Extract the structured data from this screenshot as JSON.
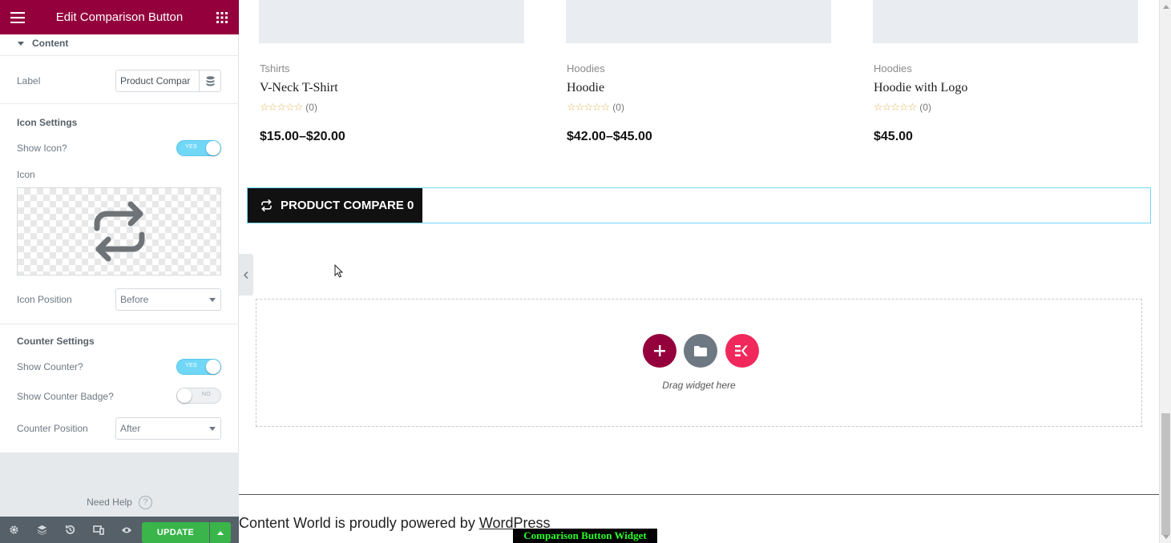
{
  "panel": {
    "title": "Edit Comparison Button",
    "section": "Content",
    "label_field": {
      "label": "Label",
      "value": "Product Compar"
    },
    "icon_settings": {
      "heading": "Icon Settings",
      "show_icon": {
        "label": "Show Icon?",
        "state": "YES"
      },
      "icon_label": "Icon",
      "icon_name": "repeat-arrows-icon",
      "icon_position": {
        "label": "Icon Position",
        "value": "Before"
      }
    },
    "counter_settings": {
      "heading": "Counter Settings",
      "show_counter": {
        "label": "Show Counter?",
        "state": "YES"
      },
      "show_counter_badge": {
        "label": "Show Counter Badge?",
        "state": "NO"
      },
      "counter_position": {
        "label": "Counter Position",
        "value": "After"
      }
    },
    "need_help": "Need Help",
    "update_label": "UPDATE",
    "colors": {
      "header": "#93003c",
      "update": "#39b54a",
      "toggle_on": "#71d7f7"
    }
  },
  "products": [
    {
      "category": "Tshirts",
      "name": "V-Neck T-Shirt",
      "rating_count": "(0)",
      "price": "$15.00–$20.00"
    },
    {
      "category": "Hoodies",
      "name": "Hoodie",
      "rating_count": "(0)",
      "price": "$42.00–$45.00"
    },
    {
      "category": "Hoodies",
      "name": "Hoodie with Logo",
      "rating_count": "(0)",
      "price": "$45.00"
    }
  ],
  "compare_button": {
    "label": "PRODUCT COMPARE 0"
  },
  "dropzone": {
    "text": "Drag widget here"
  },
  "site_footer": {
    "prefix": "Content World is proudly powered by ",
    "link": "WordPress"
  },
  "caption": "Comparison Button Widget"
}
